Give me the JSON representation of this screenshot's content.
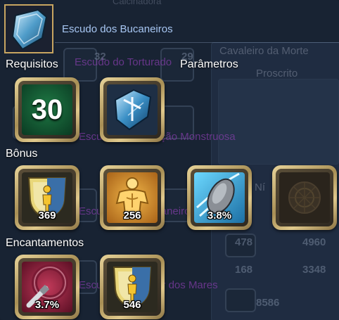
{
  "header": {
    "item_name": "Escudo dos Bucaneiros",
    "icon": "shield-icon"
  },
  "sections": {
    "requirements": "Requisitos",
    "parameters": "Parâmetros",
    "bonus": "Bônus",
    "enchantments": "Encantamentos"
  },
  "requirements": {
    "level": "30",
    "item_icon": "crystal-shield-icon"
  },
  "bonus": [
    {
      "icon": "defense-shield-icon",
      "value": "369"
    },
    {
      "icon": "body-armor-icon",
      "value": "256"
    },
    {
      "icon": "block-shield-icon",
      "value": "3.8%"
    },
    {
      "icon": "rune-stone-icon",
      "value": ""
    }
  ],
  "enchantments": [
    {
      "icon": "sword-ring-icon",
      "value": "3.7%"
    },
    {
      "icon": "defense-shield-icon",
      "value": "546"
    }
  ],
  "background": {
    "ghost_texts": [
      "Calcinadora",
      "Escudo do Torturado",
      "Cavaleiro da Morte",
      "Proscrito",
      "Escudo da Ascenção Monstruosa",
      "Escudo do Guardaneiro",
      "Escudo do Senhor dos Mares",
      "Ní"
    ],
    "ghost_numbers": [
      "32",
      "29",
      "478",
      "4960",
      "168",
      "3348",
      "8586"
    ]
  }
}
